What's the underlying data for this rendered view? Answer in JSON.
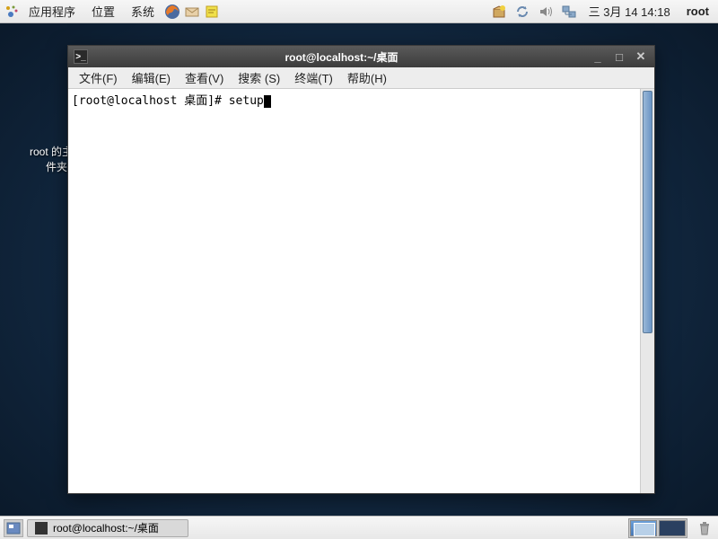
{
  "top_panel": {
    "menus": [
      "应用程序",
      "位置",
      "系统"
    ],
    "clock": "三 3月 14 14:18",
    "user": "root"
  },
  "desktop": {
    "icons": [
      {
        "label": "root 的主文件夹"
      }
    ]
  },
  "terminal": {
    "title": "root@localhost:~/桌面",
    "menubar": [
      "文件(F)",
      "编辑(E)",
      "查看(V)",
      "搜索 (S)",
      "终端(T)",
      "帮助(H)"
    ],
    "prompt": "[root@localhost 桌面]# ",
    "command": "setup"
  },
  "bottom_panel": {
    "task_label": "root@localhost:~/桌面"
  },
  "icons": {
    "gnome_foot": "gnome-foot-icon",
    "firefox": "firefox-icon",
    "mail": "mail-icon",
    "notes": "notes-icon",
    "package": "package-updater-icon",
    "sync": "sync-icon",
    "volume": "volume-icon",
    "network": "network-icon",
    "terminal_app": "terminal-app-icon",
    "show_desktop": "show-desktop-icon",
    "trash": "trash-icon"
  }
}
